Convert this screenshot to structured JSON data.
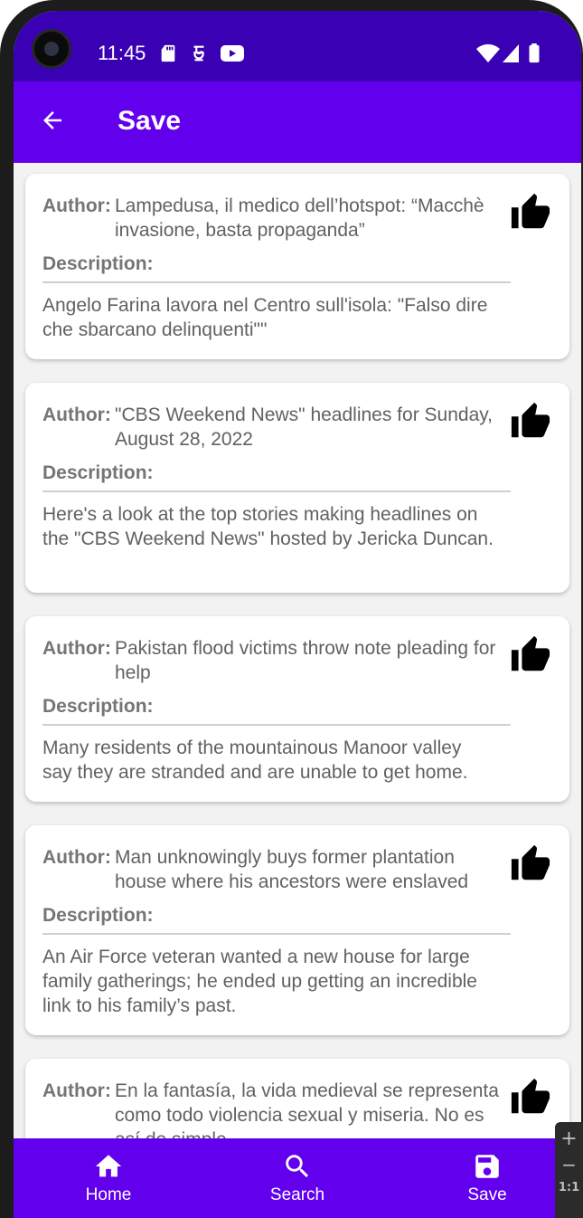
{
  "status_bar": {
    "time": "11:45",
    "left_icons": [
      "sd-card-icon",
      "debug-icon",
      "youtube-icon"
    ],
    "right_icons": [
      "wifi-icon",
      "signal-icon",
      "battery-icon"
    ]
  },
  "app_bar": {
    "title": "Save",
    "back_icon": "arrow-back-icon"
  },
  "labels": {
    "author": "Author:",
    "description": "Description:"
  },
  "articles": [
    {
      "author": "Lampedusa, il medico dell’hotspot: “Macchè invasione, basta propaganda”",
      "description": "Angelo Farina lavora nel Centro sull'isola: \"Falso dire che sbarcano delinquenti\"\""
    },
    {
      "author": "\"CBS Weekend News\" headlines for Sunday, August 28, 2022",
      "description": "Here's a look at the top stories making headlines on the \"CBS Weekend News\" hosted by Jericka Duncan."
    },
    {
      "author": "Pakistan flood victims throw note pleading for help",
      "description": "Many residents of the mountainous Manoor valley say they are stranded and are unable to get home."
    },
    {
      "author": "Man unknowingly buys former plantation house where his ancestors were enslaved",
      "description": "An Air Force veteran wanted a new house for large family gatherings; he ended up getting an incredible link to his family’s past."
    },
    {
      "author": "En la fantasía, la vida medieval se representa como todo violencia sexual y miseria. No es así de simple",
      "description": ""
    }
  ],
  "bottom_nav": {
    "items": [
      {
        "label": "Home",
        "icon": "home-icon"
      },
      {
        "label": "Search",
        "icon": "search-icon"
      },
      {
        "label": "Save",
        "icon": "save-icon"
      }
    ]
  },
  "zoom_control": {
    "plus": "+",
    "minus": "−",
    "ratio": "1:1"
  },
  "colors": {
    "status_bar": "#3a00b3",
    "app_bar": "#6200ee",
    "bottom_nav": "#6200ee",
    "background": "#f2f2f2",
    "card": "#ffffff",
    "text": "#616161",
    "label": "#757575"
  }
}
